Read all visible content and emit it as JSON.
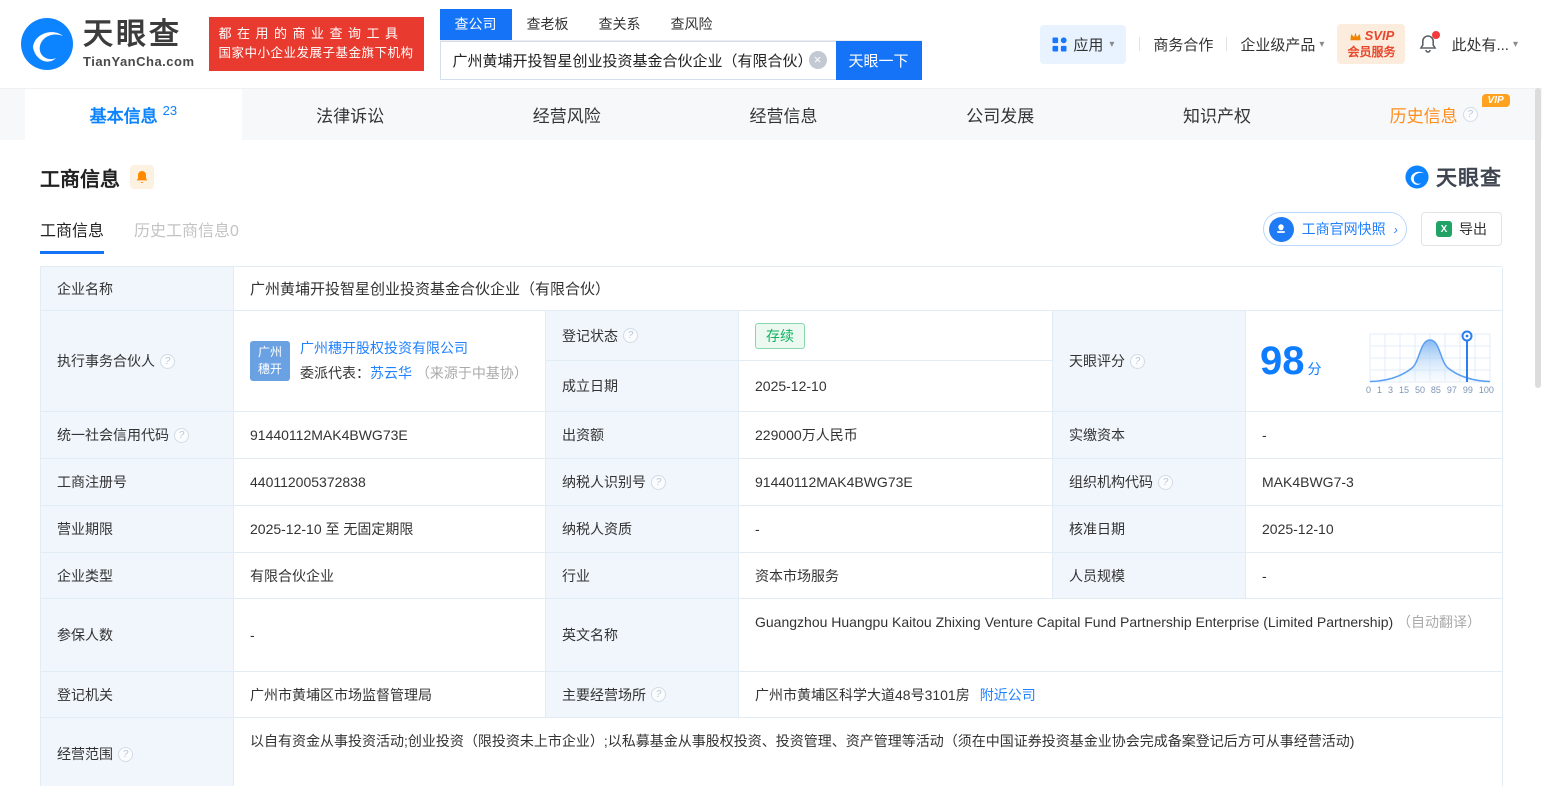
{
  "brand": {
    "name": "天眼查",
    "domain": "TianYanCha.com",
    "slogan_line1": "都在用的商业查询工具",
    "slogan_line2": "国家中小企业发展子基金旗下机构"
  },
  "search": {
    "tabs": [
      {
        "label": "查公司"
      },
      {
        "label": "查老板"
      },
      {
        "label": "查关系"
      },
      {
        "label": "查风险"
      }
    ],
    "value": "广州黄埔开投智星创业投资基金合伙企业（有限合伙）",
    "button_label": "天眼一下"
  },
  "header_right": {
    "apps_label": "应用",
    "business_label": "商务合作",
    "enterprise_label": "企业级产品",
    "svip_top": "SVIP",
    "svip_bottom": "会员服务",
    "user_label": "此处有..."
  },
  "nav": {
    "tabs": [
      {
        "label": "基本信息",
        "count": "23"
      },
      {
        "label": "法律诉讼"
      },
      {
        "label": "经营风险"
      },
      {
        "label": "经营信息"
      },
      {
        "label": "公司发展"
      },
      {
        "label": "知识产权"
      },
      {
        "label": "历史信息",
        "badge": "VIP"
      }
    ]
  },
  "section": {
    "title": "工商信息",
    "watermark": "天眼查",
    "subtab_active": "工商信息",
    "subtab_history": "历史工商信息0",
    "snapshot_label": "工商官网快照",
    "export_label": "导出"
  },
  "company": {
    "name_label": "企业名称",
    "name": "广州黄埔开投智星创业投资基金合伙企业（有限合伙）",
    "partner_label": "执行事务合伙人",
    "partner_avatar_line1": "广州",
    "partner_avatar_line2": "穗开",
    "partner_name": "广州穗开股权投资有限公司",
    "rep_label": "委派代表：",
    "rep_name": "苏云华",
    "rep_note": "（来源于中基协）",
    "reg_status_label": "登记状态",
    "reg_status": "存续",
    "establish_label": "成立日期",
    "establish_date": "2025-12-10",
    "score_label": "天眼评分",
    "score_value": "98",
    "score_unit": "分",
    "credit_code_label": "统一社会信用代码",
    "credit_code": "91440112MAK4BWG73E",
    "contribution_label": "出资额",
    "contribution": "229000万人民币",
    "paid_capital_label": "实缴资本",
    "paid_capital": "-",
    "reg_no_label": "工商注册号",
    "reg_no": "440112005372838",
    "taxpayer_id_label": "纳税人识别号",
    "taxpayer_id": "91440112MAK4BWG73E",
    "org_code_label": "组织机构代码",
    "org_code": "MAK4BWG7-3",
    "term_label": "营业期限",
    "term": "2025-12-10 至 无固定期限",
    "taxpayer_quality_label": "纳税人资质",
    "taxpayer_quality": "-",
    "approval_label": "核准日期",
    "approval_date": "2025-12-10",
    "type_label": "企业类型",
    "type": "有限合伙企业",
    "industry_label": "行业",
    "industry": "资本市场服务",
    "staff_label": "人员规模",
    "staff": "-",
    "insured_label": "参保人数",
    "insured": "-",
    "en_name_label": "英文名称",
    "en_name": "Guangzhou Huangpu Kaitou Zhixing Venture Capital Fund Partnership Enterprise (Limited Partnership)",
    "en_name_note": "（自动翻译）",
    "authority_label": "登记机关",
    "authority": "广州市黄埔区市场监督管理局",
    "site_label": "主要经营场所",
    "site": "广州市黄埔区科学大道48号3101房",
    "site_link": "附近公司",
    "scope_label": "经营范围",
    "scope": "以自有资金从事投资活动;创业投资（限投资未上市企业）;以私募基金从事股权投资、投资管理、资产管理等活动（须在中国证券投资基金业协会完成备案登记后方可从事经营活动)"
  },
  "chart_data": {
    "type": "area",
    "title": "天眼评分分布曲线",
    "score": 98,
    "marker_value": 98,
    "xticklabels": [
      "0",
      "1",
      "3",
      "15",
      "50",
      "85",
      "97",
      "99",
      "100"
    ],
    "relative_density": [
      0.02,
      0.05,
      0.16,
      0.55,
      1.0,
      0.55,
      0.16,
      0.05,
      0.02
    ],
    "grid": true,
    "legend": "off"
  },
  "icons": {
    "clear": "×",
    "caret_down": "▾",
    "arrow_right": "›",
    "help": "?",
    "excel": "X"
  },
  "colors": {
    "brand_blue": "#0d84ff",
    "button_blue": "#1473f6",
    "link_blue": "#2182ff",
    "banner_red": "#e93a2f",
    "vip_orange": "#ff8d1a",
    "status_green": "#12b25f",
    "label_bg": "#f0f6fc",
    "table_border": "#e2ecf5"
  }
}
